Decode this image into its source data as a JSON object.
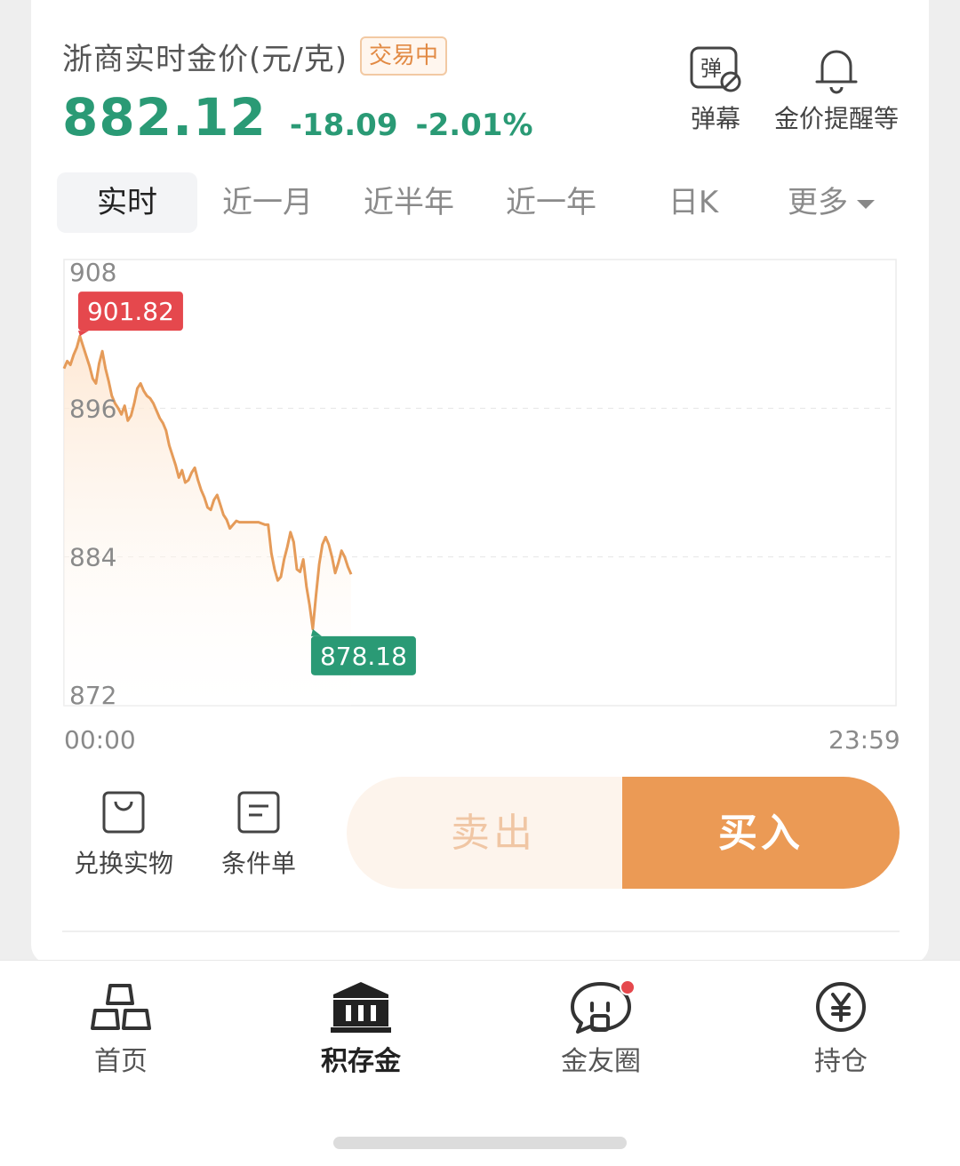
{
  "header": {
    "title": "浙商实时金价(元/克)",
    "status_badge": "交易中",
    "price": "882.12",
    "change": "-18.09",
    "change_pct": "-2.01%",
    "tools": [
      {
        "label": "弹幕",
        "icon": "danmu-icon",
        "glyph": "弹"
      },
      {
        "label": "金价提醒等",
        "icon": "bell-icon"
      }
    ]
  },
  "tabs": [
    {
      "label": "实时",
      "active": true
    },
    {
      "label": "近一月"
    },
    {
      "label": "近半年"
    },
    {
      "label": "近一年"
    },
    {
      "label": "日K"
    },
    {
      "label": "更多"
    }
  ],
  "chart_data": {
    "type": "line",
    "x_start_label": "00:00",
    "x_end_label": "23:59",
    "y_ticks": [
      908,
      896,
      884,
      872
    ],
    "ylim": [
      872,
      908
    ],
    "grid": true,
    "max_label": "901.82",
    "min_label": "878.18",
    "colors": {
      "line": "#e59b59",
      "max_tag": "#e5484d",
      "min_tag": "#2a9a75",
      "fill": "#fdeedd"
    },
    "values": [
      899.2,
      899.8,
      899.5,
      900.3,
      900.9,
      901.82,
      901.0,
      900.2,
      899.4,
      898.4,
      898.0,
      899.6,
      900.6,
      899.2,
      898.2,
      897.0,
      896.4,
      896.0,
      895.5,
      896.2,
      895.0,
      895.4,
      896.4,
      897.6,
      898.0,
      897.4,
      897.0,
      896.8,
      896.4,
      895.8,
      895.2,
      894.8,
      894.2,
      893.0,
      892.2,
      891.4,
      890.4,
      891.0,
      890.0,
      890.2,
      890.8,
      891.2,
      890.2,
      889.4,
      888.8,
      888.0,
      887.8,
      888.6,
      889.0,
      888.2,
      887.4,
      887.0,
      886.3,
      886.6,
      886.9,
      886.8,
      886.8,
      886.8,
      886.8,
      886.8,
      886.8,
      886.8,
      886.7,
      886.6,
      886.6,
      884.3,
      883.0,
      882.1,
      882.4,
      883.8,
      884.8,
      886.0,
      885.2,
      883.0,
      882.8,
      883.8,
      881.6,
      880.1,
      878.18,
      880.9,
      883.4,
      885.0,
      885.6,
      885.0,
      884.0,
      882.7,
      883.5,
      884.5,
      884.0,
      883.2,
      882.6
    ]
  },
  "actions": [
    {
      "label": "兑换实物",
      "icon": "shopping-bag-icon"
    },
    {
      "label": "条件单",
      "icon": "document-icon"
    }
  ],
  "trade": {
    "sell": "卖出",
    "buy": "买入"
  },
  "nav": [
    {
      "label": "首页",
      "icon": "gold-bars-icon"
    },
    {
      "label": "积存金",
      "icon": "bank-icon",
      "active": true
    },
    {
      "label": "金友圈",
      "icon": "chat-bubble-icon",
      "has_dot": true
    },
    {
      "label": "持仓",
      "icon": "yen-icon"
    }
  ]
}
